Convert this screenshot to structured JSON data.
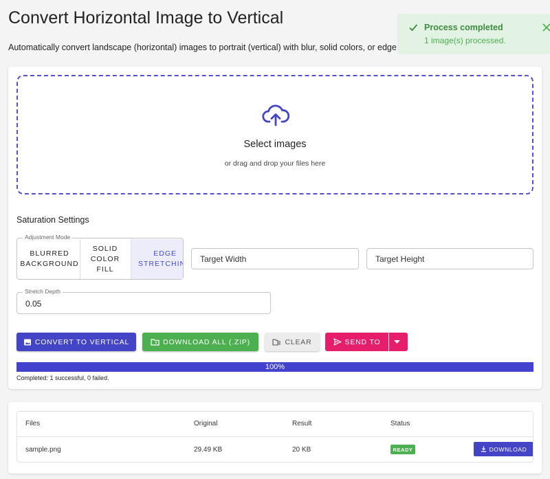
{
  "header": {
    "title": "Convert Horizontal Image to Vertical",
    "description": "Automatically convert landscape (horizontal) images to portrait (vertical) with blur, solid colors, or edge stretching."
  },
  "toast": {
    "title": "Process completed",
    "message": "1 image(s) processed."
  },
  "dropzone": {
    "title": "Select images",
    "subtitle": "or drag and drop your files here"
  },
  "settings": {
    "title": "Saturation Settings",
    "mode_legend": "Adjustment Mode",
    "modes": [
      {
        "line1": "BLURRED",
        "line2": "BACKGROUND",
        "line3": ""
      },
      {
        "line1": "SOLID",
        "line2": "COLOR",
        "line3": "FILL"
      },
      {
        "line1": "EDGE",
        "line2": "STRETCHING",
        "line3": ""
      }
    ],
    "selected_mode": "EDGE STRETCHING",
    "target_width_placeholder": "Target Width",
    "target_height_placeholder": "Target Height",
    "depth_legend": "Stretch Depth",
    "depth_value": "0.05"
  },
  "actions": {
    "convert": "CONVERT TO VERTICAL",
    "download_all": "DOWNLOAD ALL (.ZIP)",
    "clear": "CLEAR",
    "send_to": "SEND TO"
  },
  "progress": {
    "value": 100,
    "label": "100%",
    "status": "Completed: 1 successful, 0 failed."
  },
  "table": {
    "headers": [
      "Files",
      "Original",
      "Result",
      "Status"
    ],
    "rows": [
      {
        "file": "sample.png",
        "original": "29.49 KB",
        "result": "20 KB",
        "status": "READY",
        "action": "DOWNLOAD"
      }
    ]
  },
  "colors": {
    "primary": "#4444c7",
    "success": "#4caf50",
    "send": "#e61d6a",
    "toast_bg": "#e2f3e3"
  }
}
